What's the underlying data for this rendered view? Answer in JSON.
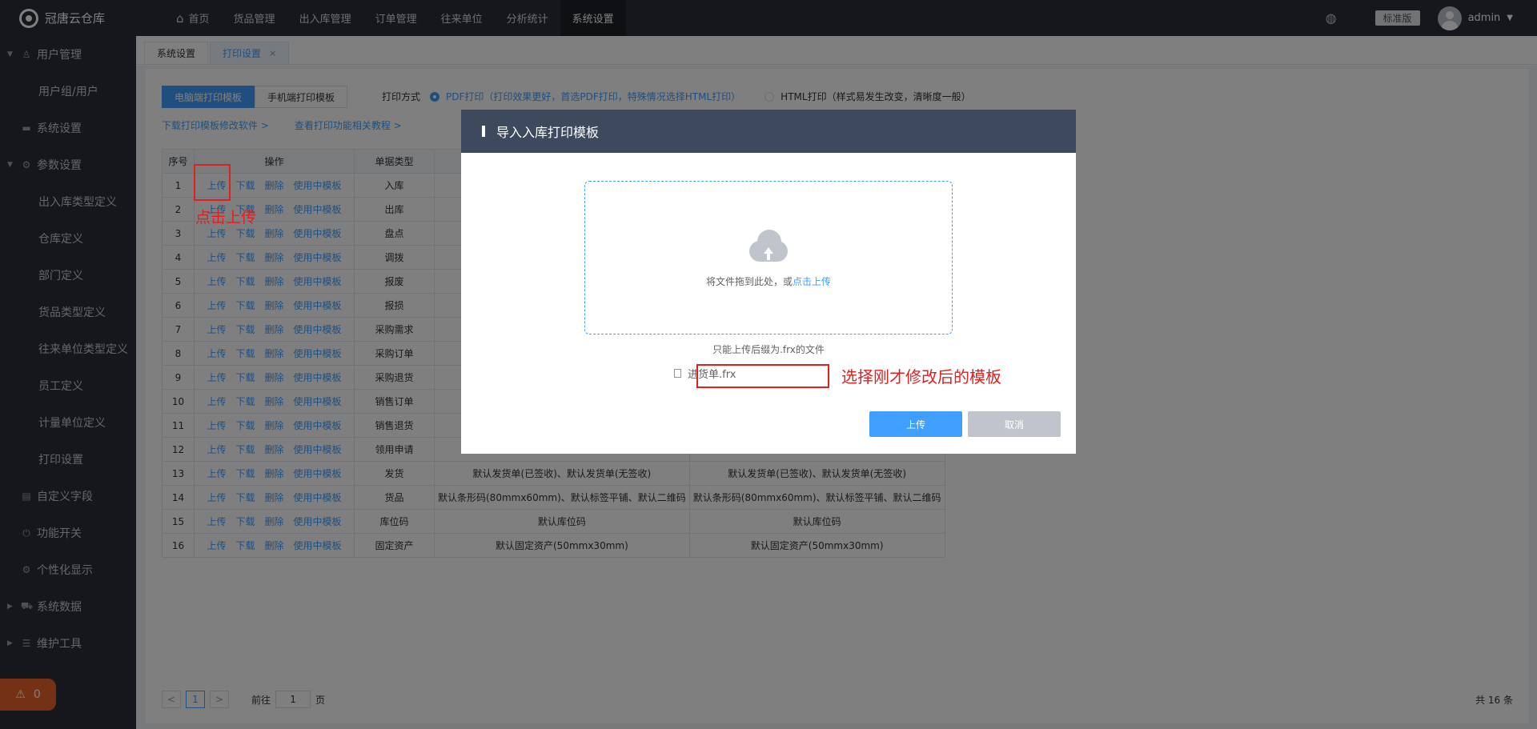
{
  "app": {
    "name": "冠唐云仓库"
  },
  "sidebar": {
    "items": [
      {
        "label": "用户管理",
        "level": "top",
        "expanded": true,
        "icon": "user-icon"
      },
      {
        "label": "用户组/用户",
        "level": "sub"
      },
      {
        "label": "系统设置",
        "level": "top",
        "expanded": false,
        "icon": "monitor-icon"
      },
      {
        "label": "参数设置",
        "level": "top",
        "expanded": true,
        "icon": "gear-icon"
      },
      {
        "label": "出入库类型定义",
        "level": "sub"
      },
      {
        "label": "仓库定义",
        "level": "sub"
      },
      {
        "label": "部门定义",
        "level": "sub"
      },
      {
        "label": "货品类型定义",
        "level": "sub"
      },
      {
        "label": "往来单位类型定义",
        "level": "sub"
      },
      {
        "label": "员工定义",
        "level": "sub"
      },
      {
        "label": "计量单位定义",
        "level": "sub"
      },
      {
        "label": "打印设置",
        "level": "sub"
      },
      {
        "label": "自定义字段",
        "level": "top",
        "expanded": false,
        "icon": "document-icon"
      },
      {
        "label": "功能开关",
        "level": "top",
        "expanded": false,
        "icon": "power-icon"
      },
      {
        "label": "个性化显示",
        "level": "top",
        "expanded": false,
        "icon": "gear-icon"
      },
      {
        "label": "系统数据",
        "level": "top",
        "expanded": false,
        "icon": "cart-icon"
      },
      {
        "label": "维护工具",
        "level": "top",
        "expanded": false,
        "icon": "database-icon"
      }
    ],
    "alarm_count": "0"
  },
  "topnav": {
    "items": [
      "首页",
      "货品管理",
      "出入库管理",
      "订单管理",
      "往来单位",
      "分析统计",
      "系统设置"
    ],
    "active_index": 6,
    "edition": "标准版",
    "user": "admin"
  },
  "tabs": [
    {
      "label": "系统设置",
      "active": false,
      "closable": false
    },
    {
      "label": "打印设置",
      "active": true,
      "closable": true,
      "close": "×"
    }
  ],
  "print_settings": {
    "template_tabs": [
      "电脑端打印模板",
      "手机端打印模板"
    ],
    "active_template_tab": 0,
    "print_mode_label": "打印方式",
    "print_modes": [
      {
        "label": "PDF打印（打印效果更好，首选PDF打印，特殊情况选择HTML打印）",
        "selected": true
      },
      {
        "label": "HTML打印（样式易发生改变，清晰度一般）",
        "selected": false
      }
    ],
    "links": [
      "下载打印模板修改软件 >",
      "查看打印功能相关教程 >"
    ]
  },
  "table": {
    "headers": [
      "序号",
      "操作",
      "单据类型",
      "",
      ""
    ],
    "op_labels": [
      "上传",
      "下载",
      "删除",
      "使用中模板"
    ],
    "rows": [
      {
        "no": "1",
        "type": "入库",
        "a": "",
        "b": ""
      },
      {
        "no": "2",
        "type": "出库",
        "a": "",
        "b": ""
      },
      {
        "no": "3",
        "type": "盘点",
        "a": "",
        "b": ""
      },
      {
        "no": "4",
        "type": "调拨",
        "a": "",
        "b": ""
      },
      {
        "no": "5",
        "type": "报废",
        "a": "",
        "b": ""
      },
      {
        "no": "6",
        "type": "报损",
        "a": "",
        "b": ""
      },
      {
        "no": "7",
        "type": "采购需求",
        "a": "",
        "b": ""
      },
      {
        "no": "8",
        "type": "采购订单",
        "a": "",
        "b": ""
      },
      {
        "no": "9",
        "type": "采购退货",
        "a": "",
        "b": ""
      },
      {
        "no": "10",
        "type": "销售订单",
        "a": "",
        "b": ""
      },
      {
        "no": "11",
        "type": "销售退货",
        "a": "",
        "b": ""
      },
      {
        "no": "12",
        "type": "领用申请",
        "a": "",
        "b": ""
      },
      {
        "no": "13",
        "type": "发货",
        "a": "默认发货单(已签收)、默认发货单(无签收)",
        "b": "默认发货单(已签收)、默认发货单(无签收)"
      },
      {
        "no": "14",
        "type": "货品",
        "a": "默认条形码(80mmx60mm)、默认标签平铺、默认二维码",
        "b": "默认条形码(80mmx60mm)、默认标签平铺、默认二维码"
      },
      {
        "no": "15",
        "type": "库位码",
        "a": "默认库位码",
        "b": "默认库位码"
      },
      {
        "no": "16",
        "type": "固定资产",
        "a": "默认固定资产(50mmx30mm)",
        "b": "默认固定资产(50mmx30mm)"
      }
    ]
  },
  "pager": {
    "prev": "<",
    "next": ">",
    "current_page": "1",
    "goto_prefix": "前往",
    "goto_value": "1",
    "goto_suffix": "页",
    "total": "共 16 条"
  },
  "modal": {
    "title": "导入入库打印模板",
    "drop_text": "将文件拖到此处，或",
    "drop_link": "点击上传",
    "tip": "只能上传后缀为.frx的文件",
    "file_name": "进货单.frx",
    "ok_label": "上传",
    "cancel_label": "取消"
  },
  "annotations": {
    "click_upload": "点击上传",
    "select_template": "选择刚才修改后的模板",
    "color": "#e02020"
  }
}
